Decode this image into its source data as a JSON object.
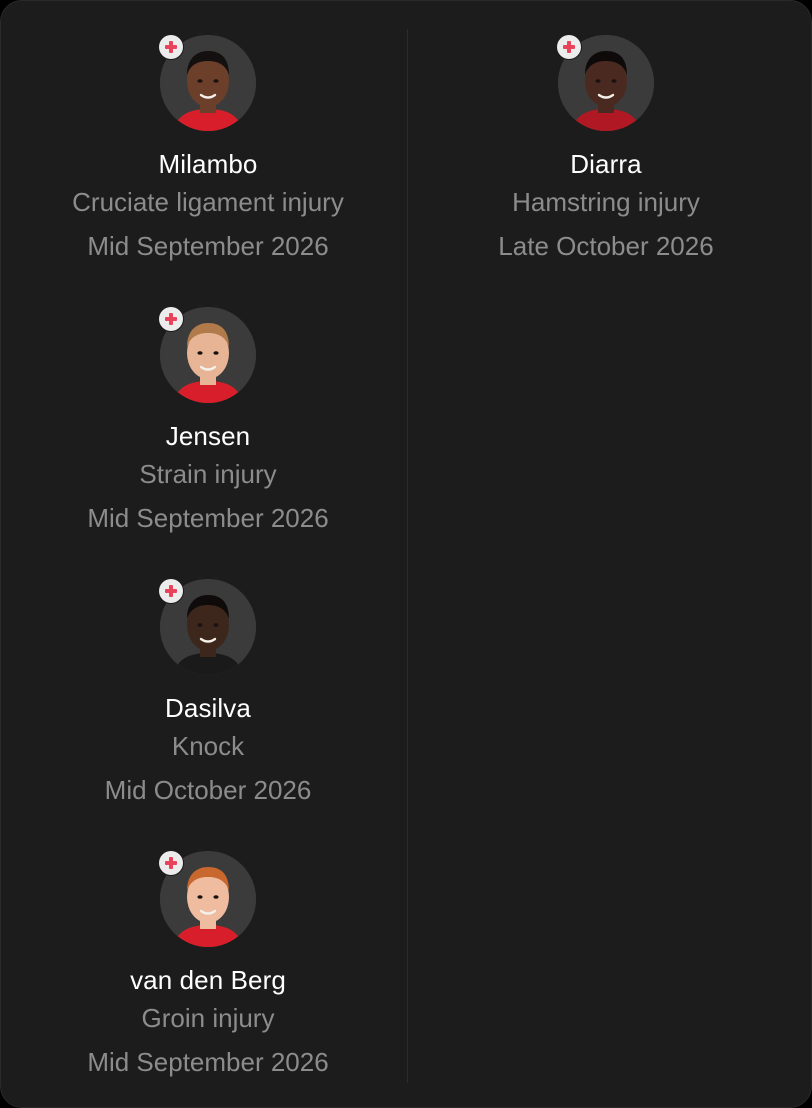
{
  "panel": {
    "left_column": [
      {
        "name": "Milambo",
        "injury": "Cruciate ligament injury",
        "return_date": "Mid September 2026",
        "badge_icon": "medical-cross-icon",
        "skin": "#6b3f2a",
        "hair": "#141010",
        "shirt": "#d81e2a"
      },
      {
        "name": "Jensen",
        "injury": "Strain injury",
        "return_date": "Mid September 2026",
        "badge_icon": "medical-cross-icon",
        "skin": "#e7b596",
        "hair": "#b07a4a",
        "shirt": "#d81e2a"
      },
      {
        "name": "Dasilva",
        "injury": "Knock",
        "return_date": "Mid October 2026",
        "badge_icon": "medical-cross-icon",
        "skin": "#3d261b",
        "hair": "#0f0b0a",
        "shirt": "#1a1a1a"
      },
      {
        "name": "van den Berg",
        "injury": "Groin injury",
        "return_date": "Mid September 2026",
        "badge_icon": "medical-cross-icon",
        "skin": "#f0bca0",
        "hair": "#c9682e",
        "shirt": "#d81e2a"
      }
    ],
    "right_column": [
      {
        "name": "Diarra",
        "injury": "Hamstring injury",
        "return_date": "Late October 2026",
        "badge_icon": "medical-cross-icon",
        "skin": "#4a2a20",
        "hair": "#0e0a09",
        "shirt": "#b01823"
      }
    ]
  },
  "colors": {
    "background": "#1c1c1c",
    "name_text": "#ffffff",
    "secondary_text": "#8c8c8c",
    "badge_cross": "#e8435a",
    "badge_bg": "#ececec"
  }
}
